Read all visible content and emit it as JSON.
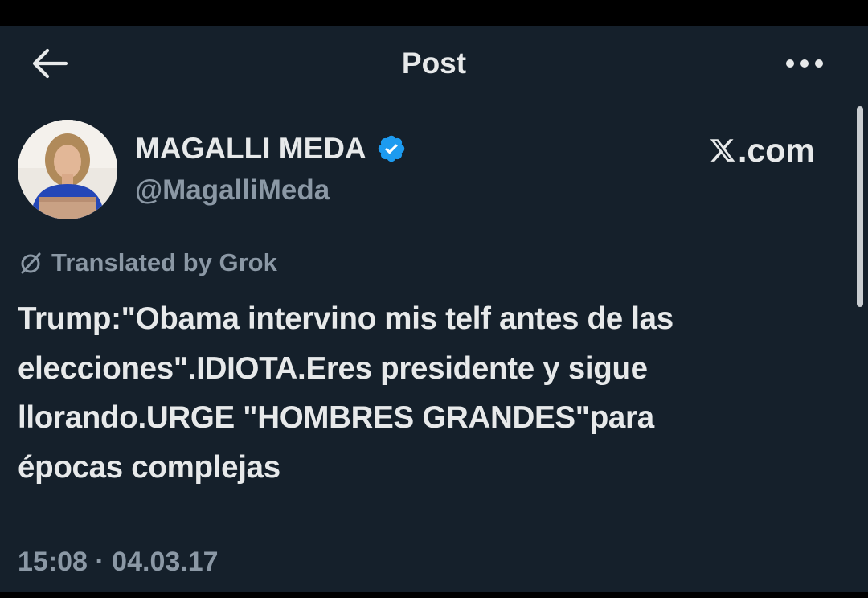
{
  "header": {
    "title": "Post",
    "back_icon": "arrow-left-icon",
    "more_icon": "ellipsis-icon"
  },
  "author": {
    "name": "MAGALLI MEDA",
    "handle": "@MagalliMeda",
    "verified_icon": "verified-badge-icon",
    "verified_color": "#1d9bf0"
  },
  "brand": {
    "logo_icon": "x-logo-icon",
    "suffix": ".com"
  },
  "translation": {
    "icon": "translate-slash-icon",
    "label": "Translated by Grok"
  },
  "tweet": {
    "lines": [
      "Trump:\"Obama intervino mis telf antes de las",
      "elecciones\".IDIOTA.Eres presidente y sigue",
      "llorando.URGE \"HOMBRES GRANDES\"para",
      "épocas complejas"
    ]
  },
  "timestamp": "15:08 · 04.03.17",
  "colors": {
    "background": "#15202b",
    "text_primary": "#e7e9ea",
    "text_secondary": "#8b98a5",
    "accent": "#1d9bf0"
  }
}
